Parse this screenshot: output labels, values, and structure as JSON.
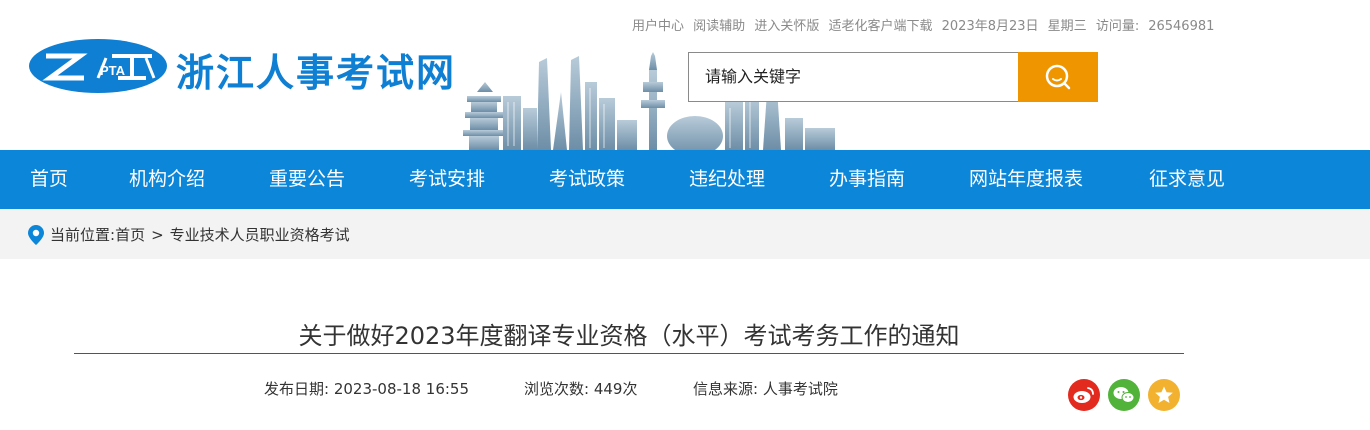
{
  "toplinks": {
    "user_center": "用户中心",
    "reading_aid": "阅读辅助",
    "care_mode": "进入关怀版",
    "elder_client": "适老化客户端下载",
    "date": "2023年8月23日",
    "weekday": "星期三",
    "visits_label": "访问量:",
    "visits_count": "26546981"
  },
  "logo": {
    "text": "PTA"
  },
  "site": {
    "title": "浙江人事考试网"
  },
  "search": {
    "placeholder": "请输入关键字"
  },
  "nav": {
    "items": [
      "首页",
      "机构介绍",
      "重要公告",
      "考试安排",
      "考试政策",
      "违纪处理",
      "办事指南",
      "网站年度报表",
      "征求意见"
    ]
  },
  "breadcrumb": {
    "label": "当前位置:",
    "home": "首页",
    "separator": ">",
    "current": "专业技术人员职业资格考试"
  },
  "article": {
    "title": "关于做好2023年度翻译专业资格（水平）考试考务工作的通知",
    "publish_label": "发布日期:",
    "publish_date": "2023-08-18 16:55",
    "views_label": "浏览次数:",
    "views_count": "449次",
    "source_label": "信息来源:",
    "source": "人事考试院"
  },
  "colors": {
    "brand_blue": "#0c86d8",
    "search_orange": "#ef9500",
    "weibo_red": "#e32a1f",
    "wechat_green": "#52b33a",
    "favorite_yellow": "#f2b22f"
  },
  "icons": [
    "logo-ellipse",
    "search-icon",
    "location-pin-icon",
    "weibo-icon",
    "wechat-icon",
    "star-icon"
  ]
}
